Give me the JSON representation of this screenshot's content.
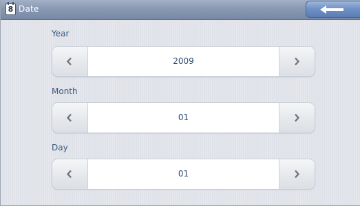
{
  "window": {
    "title": "Date",
    "icon_text": "8",
    "back_icon": "back-arrow-icon"
  },
  "fields": [
    {
      "label": "Year",
      "value": "2009",
      "prev_icon": "chevron-left-icon",
      "next_icon": "chevron-right-icon"
    },
    {
      "label": "Month",
      "value": "01",
      "prev_icon": "chevron-left-icon",
      "next_icon": "chevron-right-icon"
    },
    {
      "label": "Day",
      "value": "01",
      "prev_icon": "chevron-left-icon",
      "next_icon": "chevron-right-icon"
    }
  ],
  "colors": {
    "titlebar": "#8a99b3",
    "back_button": "#6d8fc3",
    "label_text": "#3c5a80",
    "value_text": "#2f4c73",
    "background": "#dfe2e8"
  }
}
